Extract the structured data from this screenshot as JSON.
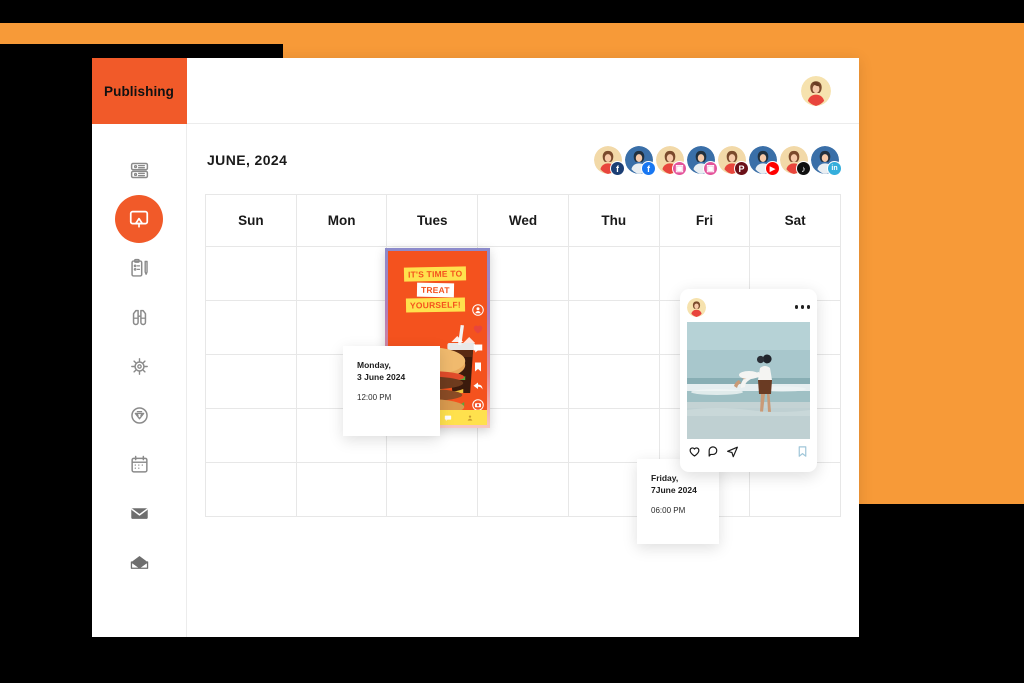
{
  "app": {
    "brand": "Publishing"
  },
  "sidebar": {
    "items": [
      {
        "icon": "dashboard-settings-icon",
        "active": false
      },
      {
        "icon": "presentation-monitor-icon",
        "active": true
      },
      {
        "icon": "clipboard-pen-icon",
        "active": false
      },
      {
        "icon": "binoculars-icon",
        "active": false
      },
      {
        "icon": "gear-icon",
        "active": false
      },
      {
        "icon": "shield-badge-icon",
        "active": false
      },
      {
        "icon": "calendar-icon",
        "active": false
      },
      {
        "icon": "envelope-closed-icon",
        "active": false
      },
      {
        "icon": "envelope-open-icon",
        "active": false
      }
    ]
  },
  "topbar": {
    "avatar": "user-avatar"
  },
  "calendar": {
    "month_title": "JUNE, 2024",
    "day_headers": [
      "Sun",
      "Mon",
      "Tues",
      "Wed",
      "Thu",
      "Fri",
      "Sat"
    ],
    "week_rows": 5
  },
  "accounts": [
    {
      "platform": "facebook",
      "glyph": "f",
      "color": "#1B3E74",
      "avatar_bg": "#F2D9A8"
    },
    {
      "platform": "facebook",
      "glyph": "f",
      "color": "#1877F2",
      "avatar_bg": "#3A6FA8"
    },
    {
      "platform": "instagram",
      "glyph": "▣",
      "color": "#E4549B",
      "avatar_bg": "#F2D9A8"
    },
    {
      "platform": "instagram",
      "glyph": "▣",
      "color": "#E4549B",
      "avatar_bg": "#3A6FA8"
    },
    {
      "platform": "pinterest",
      "glyph": "P",
      "color": "#6B1018",
      "avatar_bg": "#F2D9A8"
    },
    {
      "platform": "youtube",
      "glyph": "▶",
      "color": "#FF0000",
      "avatar_bg": "#3A6FA8"
    },
    {
      "platform": "tiktok",
      "glyph": "♪",
      "color": "#0F0F0F",
      "avatar_bg": "#F2D9A8"
    },
    {
      "platform": "linkedin",
      "glyph": "in",
      "color": "#34AEDC",
      "avatar_bg": "#3A6FA8"
    }
  ],
  "posts": [
    {
      "id": "burger-reel-post",
      "type": "story-reel",
      "headline_lines": [
        "IT'S TIME TO",
        "TREAT",
        "YOURSELF!"
      ],
      "schedule": {
        "day": "Monday,",
        "date": "3 June 2024",
        "time": "12:00 PM"
      }
    },
    {
      "id": "beach-instagram-post",
      "type": "instagram-feed",
      "schedule": {
        "day": "Friday,",
        "date": "7June 2024",
        "time": "06:00 PM"
      },
      "actions": [
        "like-heart-icon",
        "comment-bubble-icon",
        "share-send-icon",
        "bookmark-icon"
      ]
    }
  ],
  "colors": {
    "brand_orange": "#F15A29",
    "background_orange": "#F79A38",
    "background_black": "#000000",
    "grid_line": "#E7E7E7"
  }
}
